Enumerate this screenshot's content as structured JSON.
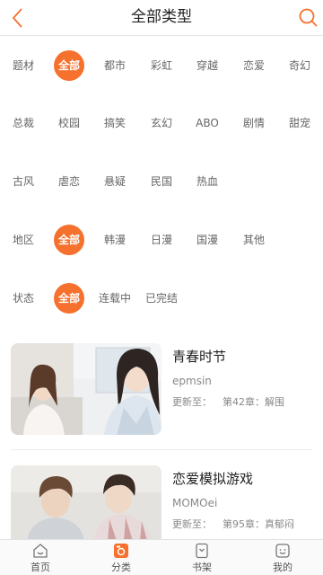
{
  "header": {
    "title": "全部类型"
  },
  "filters": {
    "theme": {
      "label": "题材",
      "row1": [
        "全部",
        "都市",
        "彩虹",
        "穿越",
        "恋爱",
        "奇幻"
      ],
      "row2": [
        "总裁",
        "校园",
        "搞笑",
        "玄幻",
        "ABO",
        "剧情",
        "甜宠"
      ],
      "row3": [
        "古风",
        "虐恋",
        "悬疑",
        "民国",
        "热血"
      ],
      "selected": "全部"
    },
    "region": {
      "label": "地区",
      "options": [
        "全部",
        "韩漫",
        "日漫",
        "国漫",
        "其他"
      ],
      "selected": "全部"
    },
    "status": {
      "label": "状态",
      "options": [
        "全部",
        "连载中",
        "已完结"
      ],
      "selected": "全部"
    }
  },
  "comics": [
    {
      "title": "青春时节",
      "author": "epmsin",
      "update_label": "更新至：",
      "update_value": "第42章：解围"
    },
    {
      "title": "恋爱模拟游戏",
      "author": "MOMOei",
      "update_label": "更新至：",
      "update_value": "第95章：真郁闷"
    }
  ],
  "bottom_nav": {
    "items": [
      {
        "label": "首页",
        "icon": "home-icon"
      },
      {
        "label": "分类",
        "icon": "category-icon"
      },
      {
        "label": "书架",
        "icon": "bookshelf-icon"
      },
      {
        "label": "我的",
        "icon": "profile-icon"
      }
    ],
    "active": "分类"
  },
  "colors": {
    "accent": "#f5712d",
    "text_primary": "#222222",
    "text_secondary": "#888888"
  }
}
